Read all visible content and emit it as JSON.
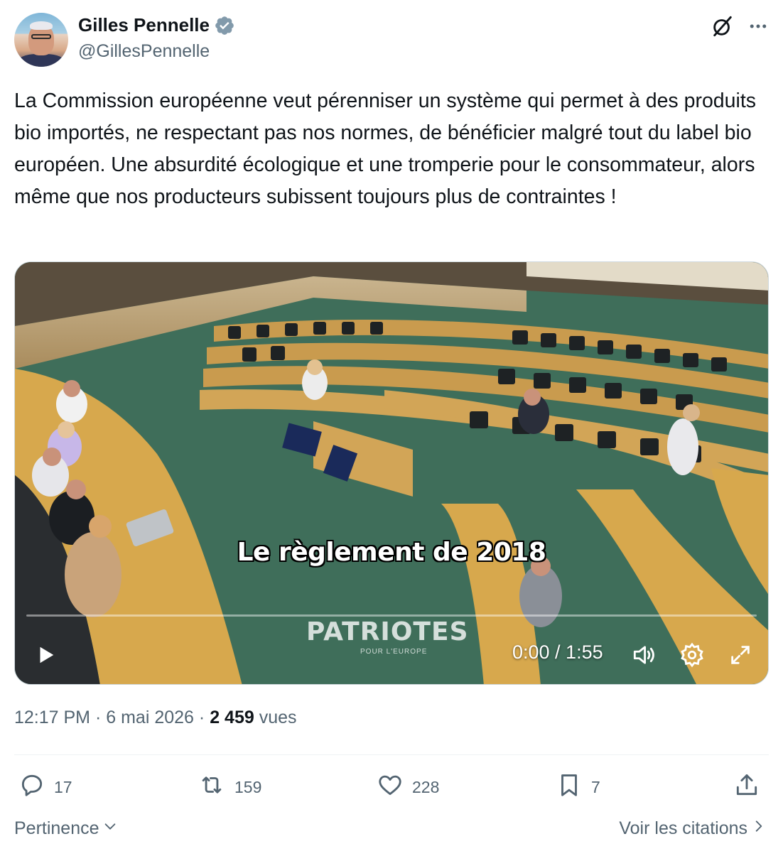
{
  "author": {
    "display_name": "Gilles Pennelle",
    "handle": "@GillesPennelle",
    "verified": true
  },
  "icons": {
    "verified": "verified-badge-icon",
    "grok": "grok-icon",
    "more": "more-icon",
    "play": "play-icon",
    "volume": "volume-icon",
    "settings": "gear-icon",
    "fullscreen": "fullscreen-icon",
    "reply": "reply-icon",
    "repost": "repost-icon",
    "like": "heart-icon",
    "bookmark": "bookmark-icon",
    "share": "share-icon"
  },
  "tweet": {
    "text": "La Commission européenne veut pérenniser un système qui permet à des produits bio importés, ne respectant pas nos normes, de bénéficier malgré tout du label bio européen. Une absurdité écologique et une tromperie pour le consommateur, alors même que nos producteurs subissent toujours plus de contraintes !"
  },
  "video": {
    "caption": "Le règlement de 2018",
    "watermark": "PATRIOTES",
    "watermark_sub": "POUR L'EUROPE",
    "time": "0:00 / 1:55",
    "progress": 0.0
  },
  "meta": {
    "time": "12:17 PM",
    "sep1": "·",
    "date": "6 mai 2026",
    "sep2": "·",
    "views_count": "2 459",
    "views_label": "vues"
  },
  "stats": {
    "replies": "17",
    "reposts": "159",
    "likes": "228",
    "bookmarks": "7"
  },
  "footer": {
    "sort_label": "Pertinence",
    "quotes_label": "Voir les citations"
  },
  "colors": {
    "text": "#0f1419",
    "secondary": "#536471",
    "verified": "#829aab",
    "divider": "#eff3f4"
  }
}
